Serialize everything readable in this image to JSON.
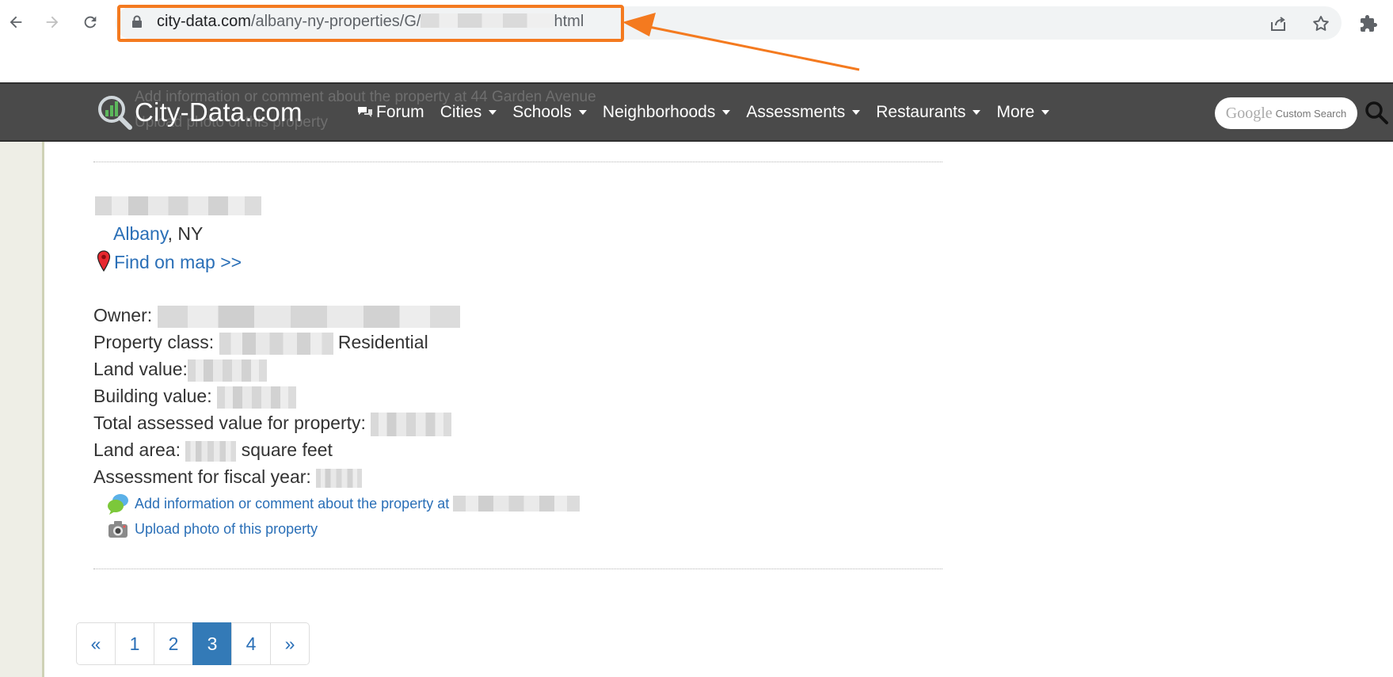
{
  "browser": {
    "url_domain": "city-data.com",
    "url_path": "/albany-ny-properties/G/",
    "url_suffix": "html",
    "accent_highlight": "#f47a1f"
  },
  "header": {
    "ghost_line_1": "Add information or comment about the property at 44 Garden Avenue",
    "ghost_line_2": "Upload photo of this property",
    "logo_text": "City-Data.com",
    "menu": [
      {
        "label": "Forum",
        "icon": "speech-bubbles-icon",
        "dropdown": false
      },
      {
        "label": "Cities",
        "dropdown": true
      },
      {
        "label": "Schools",
        "dropdown": true
      },
      {
        "label": "Neighborhoods",
        "dropdown": true
      },
      {
        "label": "Assessments",
        "dropdown": true
      },
      {
        "label": "Restaurants",
        "dropdown": true
      },
      {
        "label": "More",
        "dropdown": true
      }
    ],
    "search_google": "Google",
    "search_custom": "Custom Search",
    "bg_color": "#4a4a4a"
  },
  "property": {
    "city_link": "Albany",
    "state": ", NY",
    "find_on_map": "Find on map >>",
    "owner_label": "Owner:",
    "class_label": "Property class:",
    "class_value": "Residential",
    "land_value_label": "Land value:",
    "building_value_label": "Building value:",
    "total_label": "Total assessed value for property:",
    "land_area_label": "Land area:",
    "land_area_unit": "square feet",
    "fiscal_year_label": "Assessment for fiscal year:",
    "add_info_link": "Add information or comment about the property at",
    "upload_link": "Upload photo of this property"
  },
  "pagination": {
    "prev": "«",
    "pages": [
      "1",
      "2",
      "3",
      "4"
    ],
    "current": "3",
    "next": "»",
    "active_color": "#337ab7"
  }
}
